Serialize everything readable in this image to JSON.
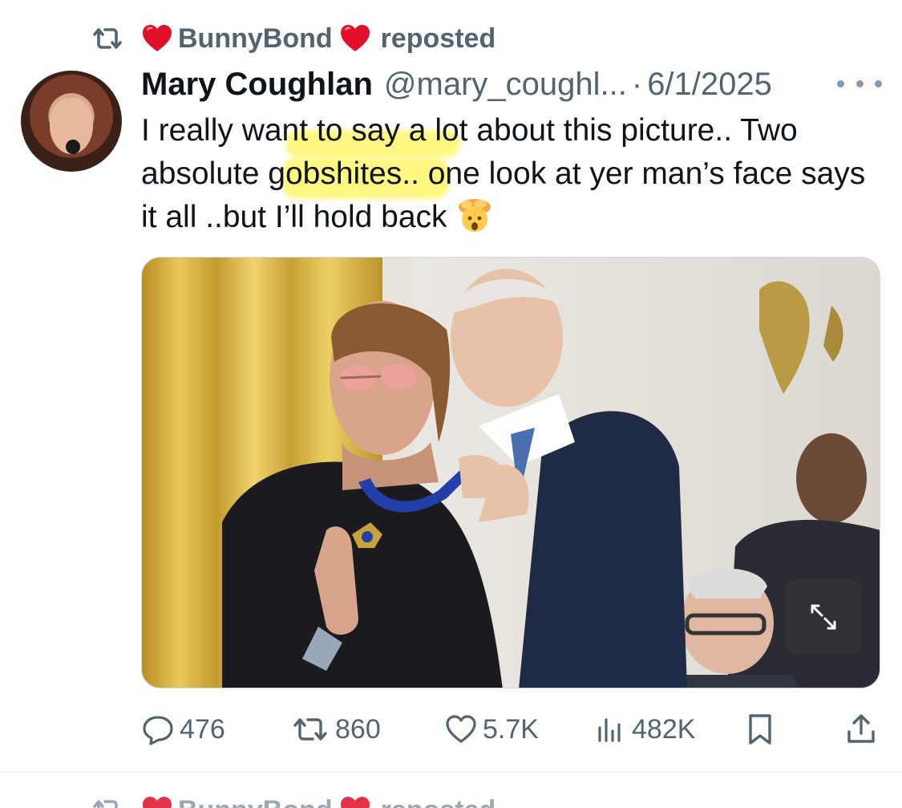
{
  "repost": {
    "icon": "retweet-icon",
    "user": "BunnyBond",
    "user_decoration": "red-heart-icon",
    "verb": "reposted"
  },
  "tweet": {
    "display_name": "Mary Coughlan",
    "handle": "@mary_coughl...",
    "separator": "·",
    "date": "6/1/2025",
    "text_part1": "I really want to say a lot about this picture.. Two absolute gobshites.. one look at yer man’s face says it all ..but I’ll hold back",
    "emoji": "exploding-head-emoji",
    "highlight_color": "#fff65a"
  },
  "media": {
    "alt": "photo",
    "expand_icon": "expand-icon"
  },
  "actions": {
    "replies": "476",
    "reposts": "860",
    "likes": "5.7K",
    "views": "482K",
    "bookmark_icon": "bookmark-icon",
    "share_icon": "share-icon"
  },
  "colors": {
    "secondary_text": "#536471",
    "primary_text": "#0f1419",
    "border": "#cfd9de",
    "heart_red": "#e0102a"
  }
}
